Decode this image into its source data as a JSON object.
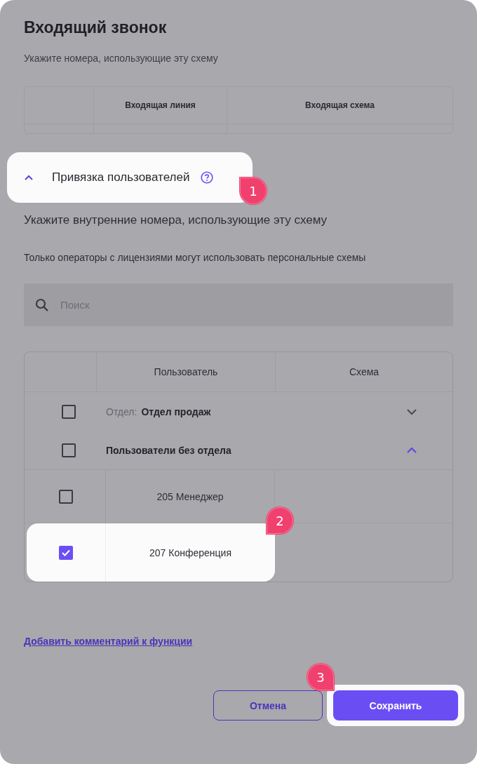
{
  "dialog": {
    "title": "Входящий звонок"
  },
  "lines_section": {
    "hint": "Укажите номера, использующие эту схему",
    "columns": [
      "Входящая линия",
      "Входящая схема"
    ]
  },
  "users_section": {
    "title": "Привязка пользователей",
    "expanded": true,
    "highlighted": true,
    "marker": "1",
    "hint": "Укажите внутренние номера, использующие эту схему",
    "note": "Только операторы с лицензиями могут использовать персональные схемы"
  },
  "search": {
    "placeholder": "Поиск"
  },
  "table": {
    "columns": [
      "Пользователь",
      "Схема"
    ],
    "groups": [
      {
        "label_prefix": "Отдел:",
        "name": "Отдел продаж",
        "checked": false,
        "expanded": false
      },
      {
        "name": "Пользователи без отдела",
        "checked": false,
        "expanded": true,
        "children": [
          {
            "name": "205 Менеджер",
            "checked": false,
            "highlighted": false
          },
          {
            "name": "207 Конференция",
            "checked": true,
            "highlighted": true,
            "marker": "2"
          }
        ]
      }
    ]
  },
  "comment_link": "Добавить комментарий к функции",
  "buttons": [
    {
      "label": "Отмена",
      "kind": "secondary",
      "highlighted": false
    },
    {
      "label": "Сохранить",
      "kind": "primary",
      "highlighted": true,
      "marker": "3"
    }
  ]
}
